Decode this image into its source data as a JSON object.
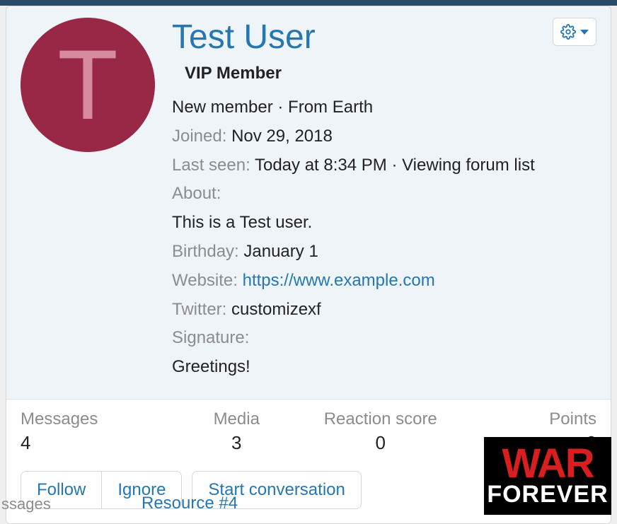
{
  "user": {
    "name": "Test User",
    "avatar_letter": "T",
    "title": "VIP Member",
    "rank": "New member",
    "from_label": "From",
    "location": "Earth",
    "joined_label": "Joined:",
    "joined": "Nov 29, 2018",
    "lastseen_label": "Last seen:",
    "lastseen": "Today at 8:34 PM",
    "activity": "Viewing forum list",
    "about_label": "About:",
    "about": "This is a Test user.",
    "birthday_label": "Birthday:",
    "birthday": "January 1",
    "website_label": "Website:",
    "website": "https://www.example.com",
    "twitter_label": "Twitter:",
    "twitter": "customizexf",
    "signature_label": "Signature:",
    "signature": "Greetings!"
  },
  "stats": {
    "messages_label": "Messages",
    "messages": "4",
    "media_label": "Media",
    "media": "3",
    "reaction_label": "Reaction score",
    "reaction": "0",
    "points_label": "Points",
    "points": "0"
  },
  "actions": {
    "follow": "Follow",
    "ignore": "Ignore",
    "start_conversation": "Start conversation"
  },
  "background": {
    "partial1": "ssages",
    "partial2": "Resource #4"
  },
  "banner": {
    "line1": "WAR",
    "line2": "FOREVER"
  }
}
